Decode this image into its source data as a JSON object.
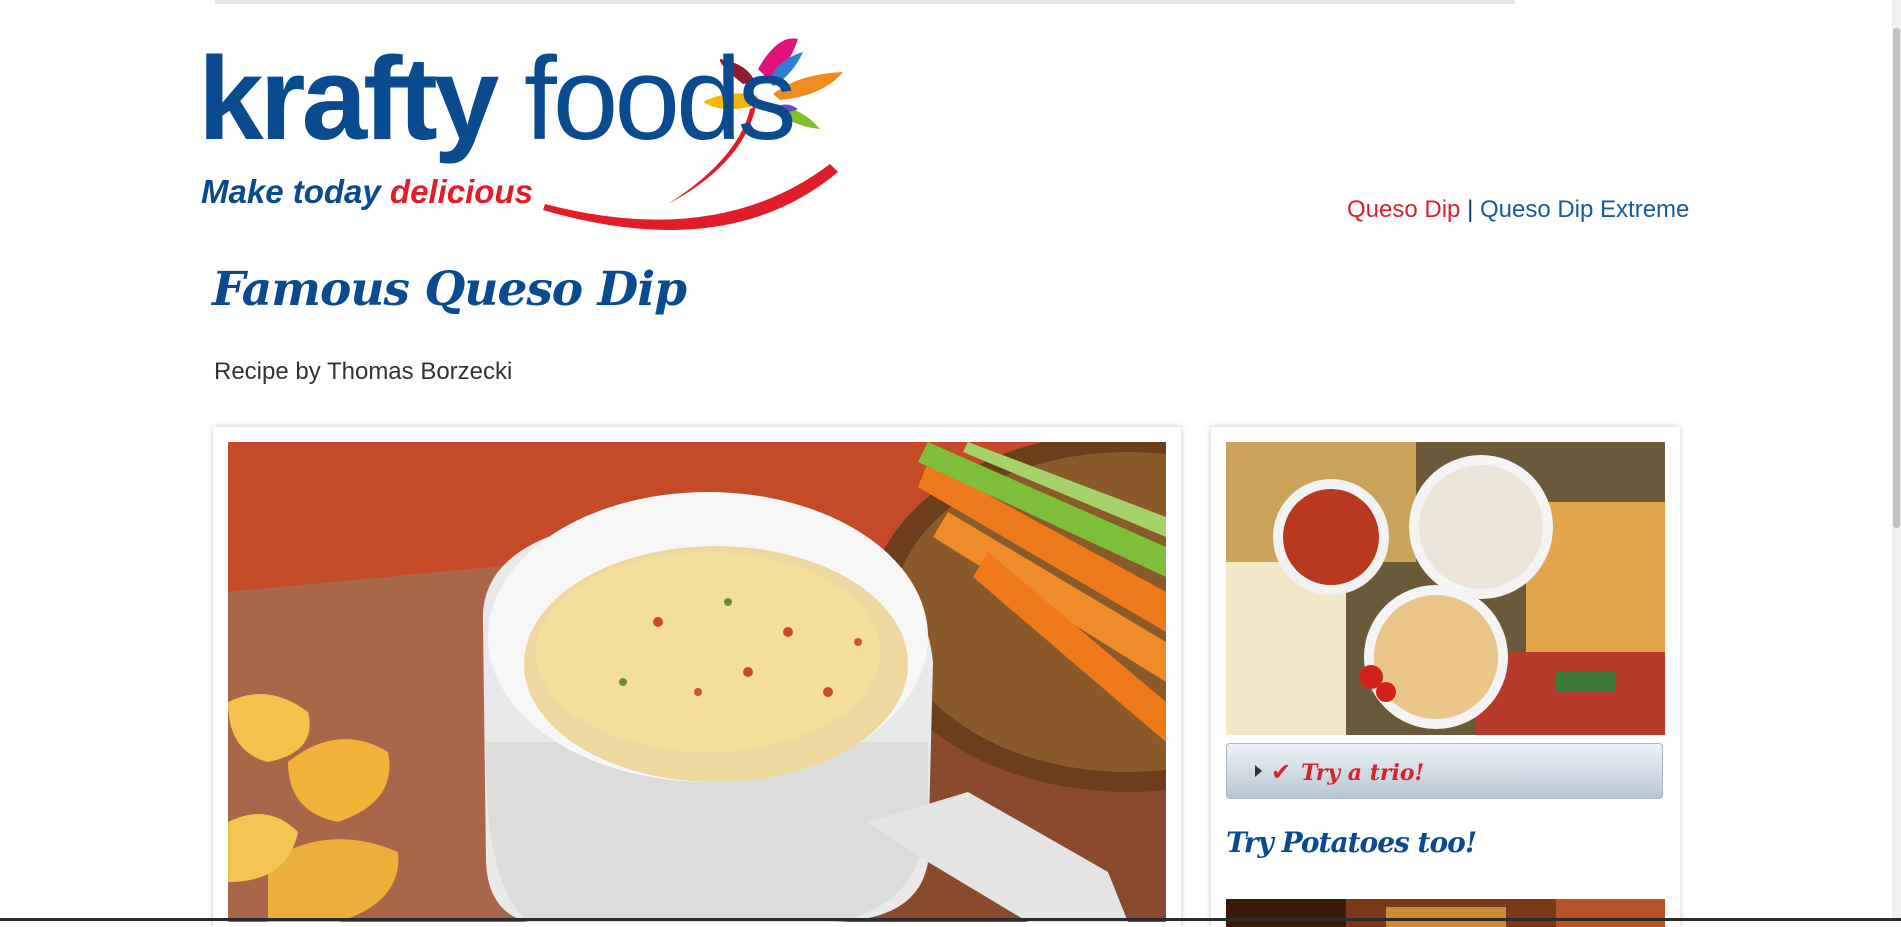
{
  "brand": {
    "name_part1": "krafty",
    "name_part2": "foods",
    "tagline_part1": "Make today ",
    "tagline_part2": "delicious",
    "primary_color": "#0a4a8e",
    "accent_color": "#e11d2a"
  },
  "nav": {
    "items": [
      {
        "label": "Queso Dip",
        "active": true
      },
      {
        "label": "Queso Dip Extreme",
        "active": false
      }
    ],
    "separator": "|"
  },
  "recipe": {
    "title": "Famous Queso Dip",
    "byline": "Recipe by Thomas Borzecki",
    "hero_image_icon": "queso-dip-photo"
  },
  "sidebar": {
    "image_icon": "dip-trio-platter-photo",
    "accordion": {
      "label": "Try a trio!",
      "check_icon": "check-icon",
      "arrow_icon": "caret-right-icon"
    },
    "heading": "Try Potatoes too!",
    "bottom_image_icon": "potatoes-photo"
  }
}
